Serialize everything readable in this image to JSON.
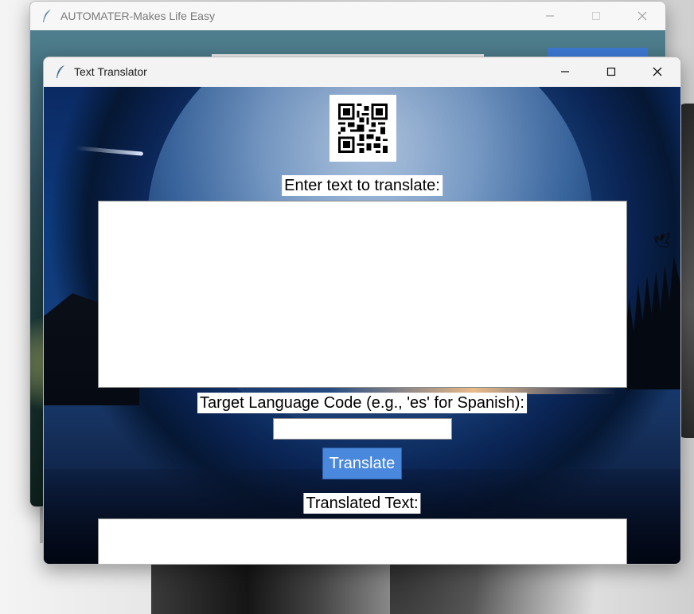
{
  "background_window": {
    "title": "AUTOMATER-Makes Life Easy",
    "icon": "feather-icon",
    "controls": [
      "minimize-icon",
      "maximize-icon",
      "close-icon"
    ]
  },
  "translator_window": {
    "title": "Text Translator",
    "icon": "feather-icon",
    "controls": [
      "minimize-icon",
      "maximize-icon",
      "close-icon"
    ],
    "qr_icon": "qr-code-icon",
    "input_label": "Enter text to translate:",
    "input_value": "",
    "target_label": "Target Language Code (e.g., 'es' for Spanish):",
    "target_value": "",
    "translate_button": "Translate",
    "output_label": "Translated Text:",
    "output_value": ""
  },
  "colors": {
    "button": "#4a88dd",
    "titlebar": "#f3f3f3"
  }
}
